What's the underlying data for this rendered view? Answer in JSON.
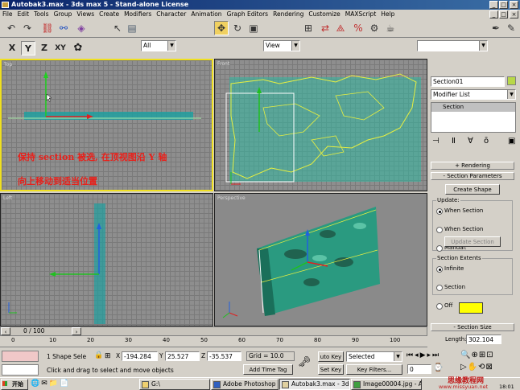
{
  "window": {
    "title": "Autobak3.max - 3ds max 5 - Stand-alone License"
  },
  "menu": [
    "File",
    "Edit",
    "Tools",
    "Group",
    "Views",
    "Create",
    "Modifiers",
    "Character",
    "Animation",
    "Graph Editors",
    "Rendering",
    "Customize",
    "MAXScript",
    "Help"
  ],
  "toolbar": {
    "filter": "All",
    "refcoord": "View"
  },
  "axes": [
    "X",
    "Y",
    "Z",
    "XY"
  ],
  "viewports": {
    "top": "Top",
    "front": "Front",
    "left": "Left",
    "persp": "Perspective"
  },
  "annotation": {
    "line1": "保持 section 被选, 在顶视图沿 Y 轴",
    "line2": "向上移动到适当位置"
  },
  "panel": {
    "name": "Section01",
    "modifier_list": "Modifier List",
    "stack_item": "Section",
    "rendering": "Rendering",
    "section_params": "Section Parameters",
    "create_shape": "Create Shape",
    "update_label": "Update:",
    "update_opts": [
      "When Section",
      "When Section",
      "Manual:"
    ],
    "update_btn": "Update Section",
    "extents_label": "Section Extents",
    "extent_opts": [
      "Infinite",
      "Section",
      "Off"
    ],
    "swatch": "#ffff00",
    "section_size": "Section Size",
    "length_label": "Length:",
    "length_value": "302.104"
  },
  "timeline": {
    "frame": "0 / 100",
    "ticks": [
      "0",
      "10",
      "20",
      "30",
      "40",
      "50",
      "60",
      "70",
      "80",
      "90",
      "100"
    ]
  },
  "status": {
    "selection": "1 Shape Sele",
    "x": "-194.284",
    "y": "25.527",
    "z": "-35.537",
    "grid": "Grid = 10.0",
    "prompt": "Click and drag to select and move objects",
    "add_time_tag": "Add Time Tag",
    "autokey": "uto Key",
    "selected": "Selected",
    "setkey": "Set Key",
    "keyfilters": "Key Filters...",
    "frame_field": "0"
  },
  "taskbar": {
    "start": "开始",
    "items": [
      "G:\\",
      "Adobe Photoshop",
      "Autobak3.max - 3ds ...",
      "Image00004.jpg - AC..."
    ],
    "watermark": "思缘教程网",
    "watermark_url": "www.missyuan.net",
    "clock": "18:01"
  }
}
